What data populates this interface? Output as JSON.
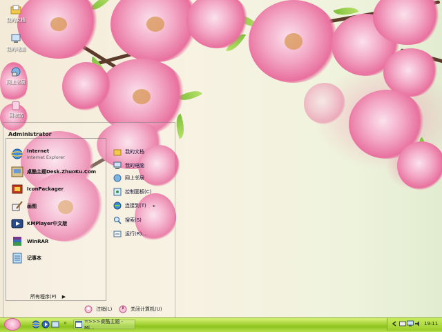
{
  "desktop": {
    "icons": [
      {
        "label": "我的文档",
        "icon": "folder-documents-icon"
      },
      {
        "label": "我的电脑",
        "icon": "computer-icon"
      },
      {
        "label": "网上邻居",
        "icon": "network-icon"
      },
      {
        "label": "回收站",
        "icon": "recycle-bin-icon"
      }
    ]
  },
  "start_menu": {
    "user": "Administrator",
    "pinned": [
      {
        "title": "Internet",
        "subtitle": "Internet Explorer",
        "icon": "internet-explorer-icon"
      },
      {
        "title": "桌酷主题Desk.ZhuoKu.Com",
        "icon": "zhuoku-theme-icon"
      },
      {
        "title": "IconPackager",
        "icon": "iconpackager-icon"
      },
      {
        "title": "画图",
        "icon": "paint-icon"
      },
      {
        "title": "KMPlayer中文版",
        "icon": "kmplayer-icon"
      },
      {
        "title": "WinRAR",
        "icon": "winrar-icon"
      },
      {
        "title": "记事本",
        "icon": "notepad-icon"
      }
    ],
    "all_programs": "所有程序(P)",
    "right": [
      {
        "label": "我的文档",
        "icon": "my-documents-icon"
      },
      {
        "label": "我的电脑",
        "icon": "my-computer-icon"
      },
      {
        "label": "网上邻居",
        "icon": "network-places-icon"
      },
      {
        "label": "控制面板(C)",
        "icon": "control-panel-icon"
      },
      {
        "label": "连接到(T)",
        "icon": "connect-to-icon",
        "submenu": "▸"
      },
      {
        "label": "搜索(S)",
        "icon": "search-icon"
      },
      {
        "label": "运行(R)...",
        "icon": "run-icon"
      }
    ],
    "logoff": "注销(L)",
    "shutdown": "关闭计算机(U)"
  },
  "taskbar": {
    "quick_launch_sep": "»",
    "task_label": "=>>>桌酷主题 - Mi...",
    "clock": "19:11"
  },
  "colors": {
    "taskbar": "#a8d63a",
    "accent_pink": "#e8709e"
  }
}
